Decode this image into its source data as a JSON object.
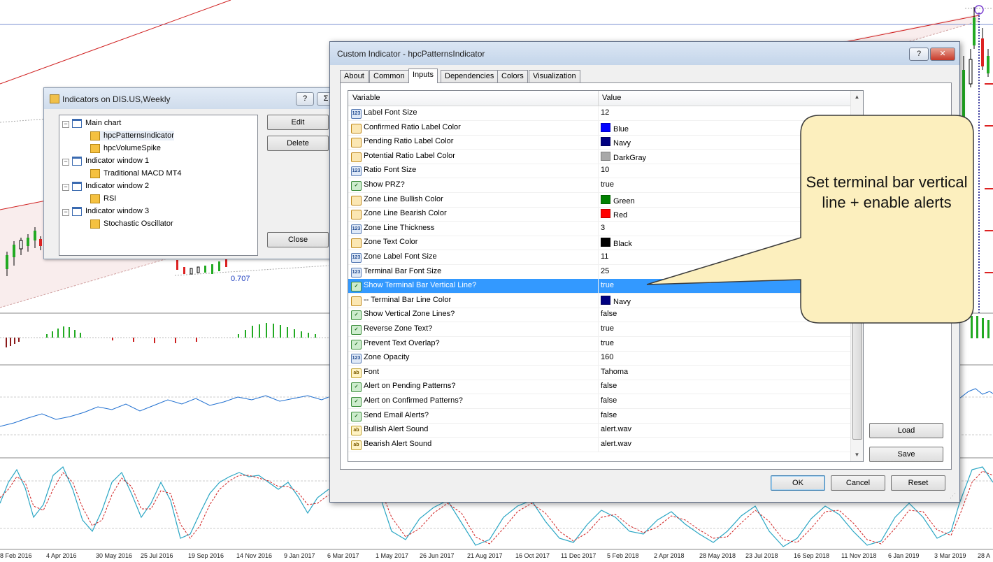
{
  "chart": {
    "level_label": "0.707",
    "date_labels": [
      "8 Feb 2016",
      "4 Apr 2016",
      "30 May 2016",
      "25 Jul 2016",
      "19 Sep 2016",
      "14 Nov 2016",
      "9 Jan 2017",
      "6 Mar 2017",
      "1 May 2017",
      "26 Jun 2017",
      "21 Aug 2017",
      "16 Oct 2017",
      "11 Dec 2017",
      "5 Feb 2018",
      "2 Apr 2018",
      "28 May 2018",
      "23 Jul 2018",
      "16 Sep 2018",
      "11 Nov 2018",
      "6 Jan 2019",
      "3 Mar 2019",
      "28 A"
    ]
  },
  "indicators_window": {
    "title": "Indicators on DIS.US,Weekly",
    "help_btn": "?",
    "close_btn": "Σ",
    "tree": [
      {
        "label": "Main chart"
      },
      {
        "label": "hpcPatternsIndicator"
      },
      {
        "label": "hpcVolumeSpike"
      },
      {
        "label": "Indicator window 1"
      },
      {
        "label": "Traditional MACD MT4"
      },
      {
        "label": "Indicator window 2"
      },
      {
        "label": "RSI"
      },
      {
        "label": "Indicator window 3"
      },
      {
        "label": "Stochastic Oscillator"
      }
    ],
    "buttons": {
      "edit": "Edit",
      "delete": "Delete",
      "close": "Close"
    }
  },
  "dialog": {
    "title": "Custom Indicator - hpcPatternsIndicator",
    "help_btn": "?",
    "tabs": [
      "About",
      "Common",
      "Inputs",
      "Dependencies",
      "Colors",
      "Visualization"
    ],
    "active_tab": "Inputs",
    "columns": {
      "variable": "Variable",
      "value": "Value"
    },
    "rows": [
      {
        "type": "int",
        "variable": "Label Font Size",
        "value": "12"
      },
      {
        "type": "color",
        "variable": "Confirmed Ratio Label Color",
        "value": "Blue",
        "swatch": "#0000ff"
      },
      {
        "type": "color",
        "variable": "Pending Ratio Label Color",
        "value": "Navy",
        "swatch": "#000080"
      },
      {
        "type": "color",
        "variable": "Potential Ratio Label Color",
        "value": "DarkGray",
        "swatch": "#a9a9a9"
      },
      {
        "type": "int",
        "variable": "Ratio Font Size",
        "value": "10"
      },
      {
        "type": "bool",
        "variable": "Show PRZ?",
        "value": "true"
      },
      {
        "type": "color",
        "variable": "Zone Line Bullish Color",
        "value": "Green",
        "swatch": "#008000"
      },
      {
        "type": "color",
        "variable": "Zone Line Bearish Color",
        "value": "Red",
        "swatch": "#ff0000"
      },
      {
        "type": "int",
        "variable": "Zone Line Thickness",
        "value": "3"
      },
      {
        "type": "color",
        "variable": "Zone Text Color",
        "value": "Black",
        "swatch": "#000000"
      },
      {
        "type": "int",
        "variable": "Zone Label Font Size",
        "value": "11"
      },
      {
        "type": "int",
        "variable": "Terminal Bar Font Size",
        "value": "25"
      },
      {
        "type": "bool",
        "variable": "Show Terminal Bar Vertical Line?",
        "value": "true",
        "selected": true
      },
      {
        "type": "color",
        "variable": "-- Terminal Bar Line Color",
        "value": "Navy",
        "swatch": "#000080"
      },
      {
        "type": "bool",
        "variable": "Show Vertical Zone Lines?",
        "value": "false"
      },
      {
        "type": "bool",
        "variable": "Reverse Zone Text?",
        "value": "true"
      },
      {
        "type": "bool",
        "variable": "Prevent Text Overlap?",
        "value": "true"
      },
      {
        "type": "int",
        "variable": "Zone Opacity",
        "value": "160"
      },
      {
        "type": "str",
        "variable": "Font",
        "value": "Tahoma"
      },
      {
        "type": "bool",
        "variable": "Alert on Pending Patterns?",
        "value": "false"
      },
      {
        "type": "bool",
        "variable": "Alert on Confirmed Patterns?",
        "value": "false"
      },
      {
        "type": "bool",
        "variable": "Send Email Alerts?",
        "value": "false"
      },
      {
        "type": "str",
        "variable": "Bullish Alert Sound",
        "value": "alert.wav"
      },
      {
        "type": "str",
        "variable": "Bearish Alert Sound",
        "value": "alert.wav"
      }
    ],
    "side_buttons": {
      "load": "Load",
      "save": "Save"
    },
    "footer_buttons": {
      "ok": "OK",
      "cancel": "Cancel",
      "reset": "Reset"
    }
  },
  "callout": {
    "text": "Set terminal bar vertical line + enable alerts",
    "fill": "#fcefbe",
    "stroke": "#3a3a3a"
  }
}
